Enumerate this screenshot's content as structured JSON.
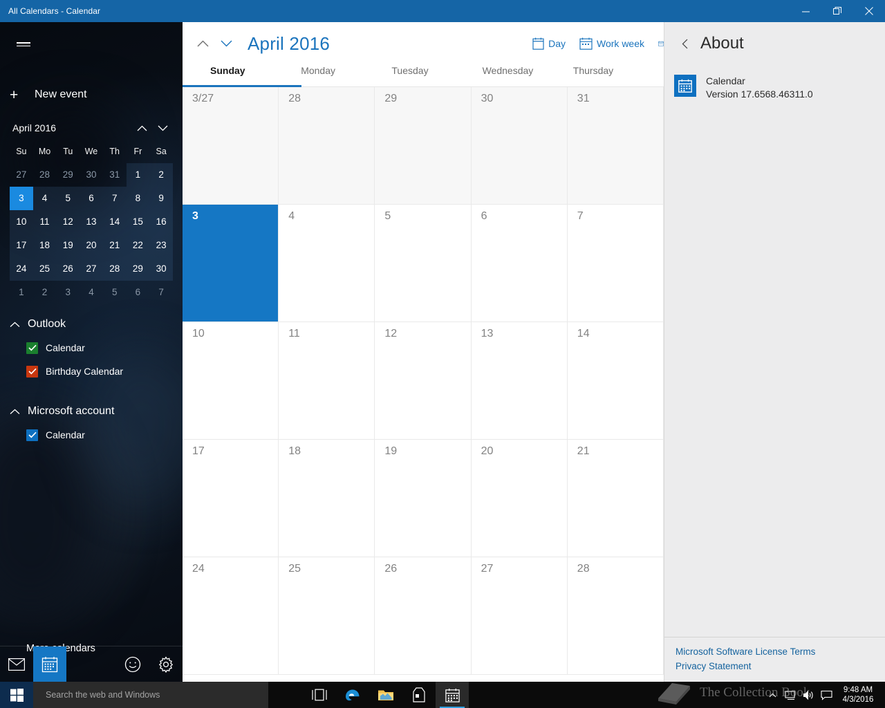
{
  "window": {
    "title": "All Calendars - Calendar",
    "accent_color": "#1565a6",
    "controls": {
      "minimize": "minimize-button",
      "restore": "restore-button",
      "close": "close-button"
    }
  },
  "sidebar": {
    "menu_icon": "hamburger-icon",
    "new_event_label": "New event",
    "mini_calendar": {
      "title": "April 2016",
      "prev_label": "Previous month",
      "next_label": "Next month",
      "day_headers": [
        "Su",
        "Mo",
        "Tu",
        "We",
        "Th",
        "Fr",
        "Sa"
      ],
      "selected_day": "3",
      "weeks": [
        [
          {
            "d": "27",
            "m": "prev"
          },
          {
            "d": "28",
            "m": "prev"
          },
          {
            "d": "29",
            "m": "prev"
          },
          {
            "d": "30",
            "m": "prev"
          },
          {
            "d": "31",
            "m": "prev"
          },
          {
            "d": "1",
            "m": "cur"
          },
          {
            "d": "2",
            "m": "cur"
          }
        ],
        [
          {
            "d": "3",
            "m": "cur",
            "sel": true
          },
          {
            "d": "4",
            "m": "cur"
          },
          {
            "d": "5",
            "m": "cur"
          },
          {
            "d": "6",
            "m": "cur"
          },
          {
            "d": "7",
            "m": "cur"
          },
          {
            "d": "8",
            "m": "cur"
          },
          {
            "d": "9",
            "m": "cur"
          }
        ],
        [
          {
            "d": "10",
            "m": "cur"
          },
          {
            "d": "11",
            "m": "cur"
          },
          {
            "d": "12",
            "m": "cur"
          },
          {
            "d": "13",
            "m": "cur"
          },
          {
            "d": "14",
            "m": "cur"
          },
          {
            "d": "15",
            "m": "cur"
          },
          {
            "d": "16",
            "m": "cur"
          }
        ],
        [
          {
            "d": "17",
            "m": "cur"
          },
          {
            "d": "18",
            "m": "cur"
          },
          {
            "d": "19",
            "m": "cur"
          },
          {
            "d": "20",
            "m": "cur"
          },
          {
            "d": "21",
            "m": "cur"
          },
          {
            "d": "22",
            "m": "cur"
          },
          {
            "d": "23",
            "m": "cur"
          }
        ],
        [
          {
            "d": "24",
            "m": "cur"
          },
          {
            "d": "25",
            "m": "cur"
          },
          {
            "d": "26",
            "m": "cur"
          },
          {
            "d": "27",
            "m": "cur"
          },
          {
            "d": "28",
            "m": "cur"
          },
          {
            "d": "29",
            "m": "cur"
          },
          {
            "d": "30",
            "m": "cur"
          }
        ],
        [
          {
            "d": "1",
            "m": "next"
          },
          {
            "d": "2",
            "m": "next"
          },
          {
            "d": "3",
            "m": "next"
          },
          {
            "d": "4",
            "m": "next"
          },
          {
            "d": "5",
            "m": "next"
          },
          {
            "d": "6",
            "m": "next"
          },
          {
            "d": "7",
            "m": "next"
          }
        ]
      ]
    },
    "accounts": [
      {
        "name": "Outlook",
        "expanded": true,
        "calendars": [
          {
            "label": "Calendar",
            "checked": true,
            "color": "#1a7f2e"
          },
          {
            "label": "Birthday Calendar",
            "checked": true,
            "color": "#c8370f"
          }
        ]
      },
      {
        "name": "Microsoft account",
        "expanded": true,
        "calendars": [
          {
            "label": "Calendar",
            "checked": true,
            "color": "#0e70c0"
          }
        ]
      }
    ],
    "more_calendars_label": "More calendars",
    "bottom_bar": [
      {
        "icon": "mail-icon",
        "name": "mail-app-button",
        "active": false
      },
      {
        "icon": "calendar-icon",
        "name": "calendar-app-button",
        "active": true
      },
      {
        "icon": "feedback-smiley-icon",
        "name": "feedback-button",
        "active": false
      },
      {
        "icon": "gear-icon",
        "name": "settings-button",
        "active": false
      }
    ]
  },
  "main": {
    "prev_icon": "chevron-up-icon",
    "next_icon": "chevron-down-icon",
    "month_title": "April 2016",
    "title_color": "#1b74bd",
    "views": [
      {
        "label": "Day",
        "icon": "calendar-day-icon"
      },
      {
        "label": "Work week",
        "icon": "calendar-workweek-icon"
      },
      {
        "label": "",
        "icon": "calendar-week-icon"
      }
    ],
    "day_headers": [
      "Sunday",
      "Monday",
      "Tuesday",
      "Wednesday",
      "Thursday"
    ],
    "active_day_header": "Sunday",
    "today_cell": "3",
    "grid": [
      [
        {
          "d": "3/27",
          "dim": true
        },
        {
          "d": "28",
          "dim": true
        },
        {
          "d": "29",
          "dim": true
        },
        {
          "d": "30",
          "dim": true
        },
        {
          "d": "31",
          "dim": true
        }
      ],
      [
        {
          "d": "3",
          "today": true
        },
        {
          "d": "4"
        },
        {
          "d": "5"
        },
        {
          "d": "6"
        },
        {
          "d": "7"
        }
      ],
      [
        {
          "d": "10"
        },
        {
          "d": "11"
        },
        {
          "d": "12"
        },
        {
          "d": "13"
        },
        {
          "d": "14"
        }
      ],
      [
        {
          "d": "17"
        },
        {
          "d": "18"
        },
        {
          "d": "19"
        },
        {
          "d": "20"
        },
        {
          "d": "21"
        }
      ],
      [
        {
          "d": "24"
        },
        {
          "d": "25"
        },
        {
          "d": "26"
        },
        {
          "d": "27"
        },
        {
          "d": "28"
        }
      ]
    ]
  },
  "about": {
    "back_icon": "chevron-left-icon",
    "title": "About",
    "app_icon": "calendar-app-tile-icon",
    "app_name": "Calendar",
    "app_version": "Version 17.6568.46311.0",
    "links": [
      "Microsoft Software License Terms",
      "Privacy Statement"
    ],
    "link_color": "#15639e"
  },
  "taskbar": {
    "start_icon": "windows-logo-icon",
    "search_placeholder": "Search the web and Windows",
    "items": [
      {
        "icon": "task-view-icon",
        "name": "task-view-button",
        "active": false
      },
      {
        "icon": "edge-browser-icon",
        "name": "edge-button",
        "active": false
      },
      {
        "icon": "file-explorer-icon",
        "name": "file-explorer-button",
        "active": false
      },
      {
        "icon": "store-icon",
        "name": "store-button",
        "active": false
      },
      {
        "icon": "calendar-icon",
        "name": "calendar-taskbar-button",
        "active": true
      }
    ],
    "tray": [
      {
        "icon": "chevron-up-icon",
        "name": "show-hidden-icons-button"
      },
      {
        "icon": "network-icon",
        "name": "network-button"
      },
      {
        "icon": "volume-icon",
        "name": "volume-button"
      },
      {
        "icon": "action-center-icon",
        "name": "action-center-button"
      }
    ],
    "clock_time": "9:48 AM",
    "clock_date": "4/3/2016"
  },
  "watermark": {
    "text": "The Collection Book",
    "icon": "book-icon"
  }
}
